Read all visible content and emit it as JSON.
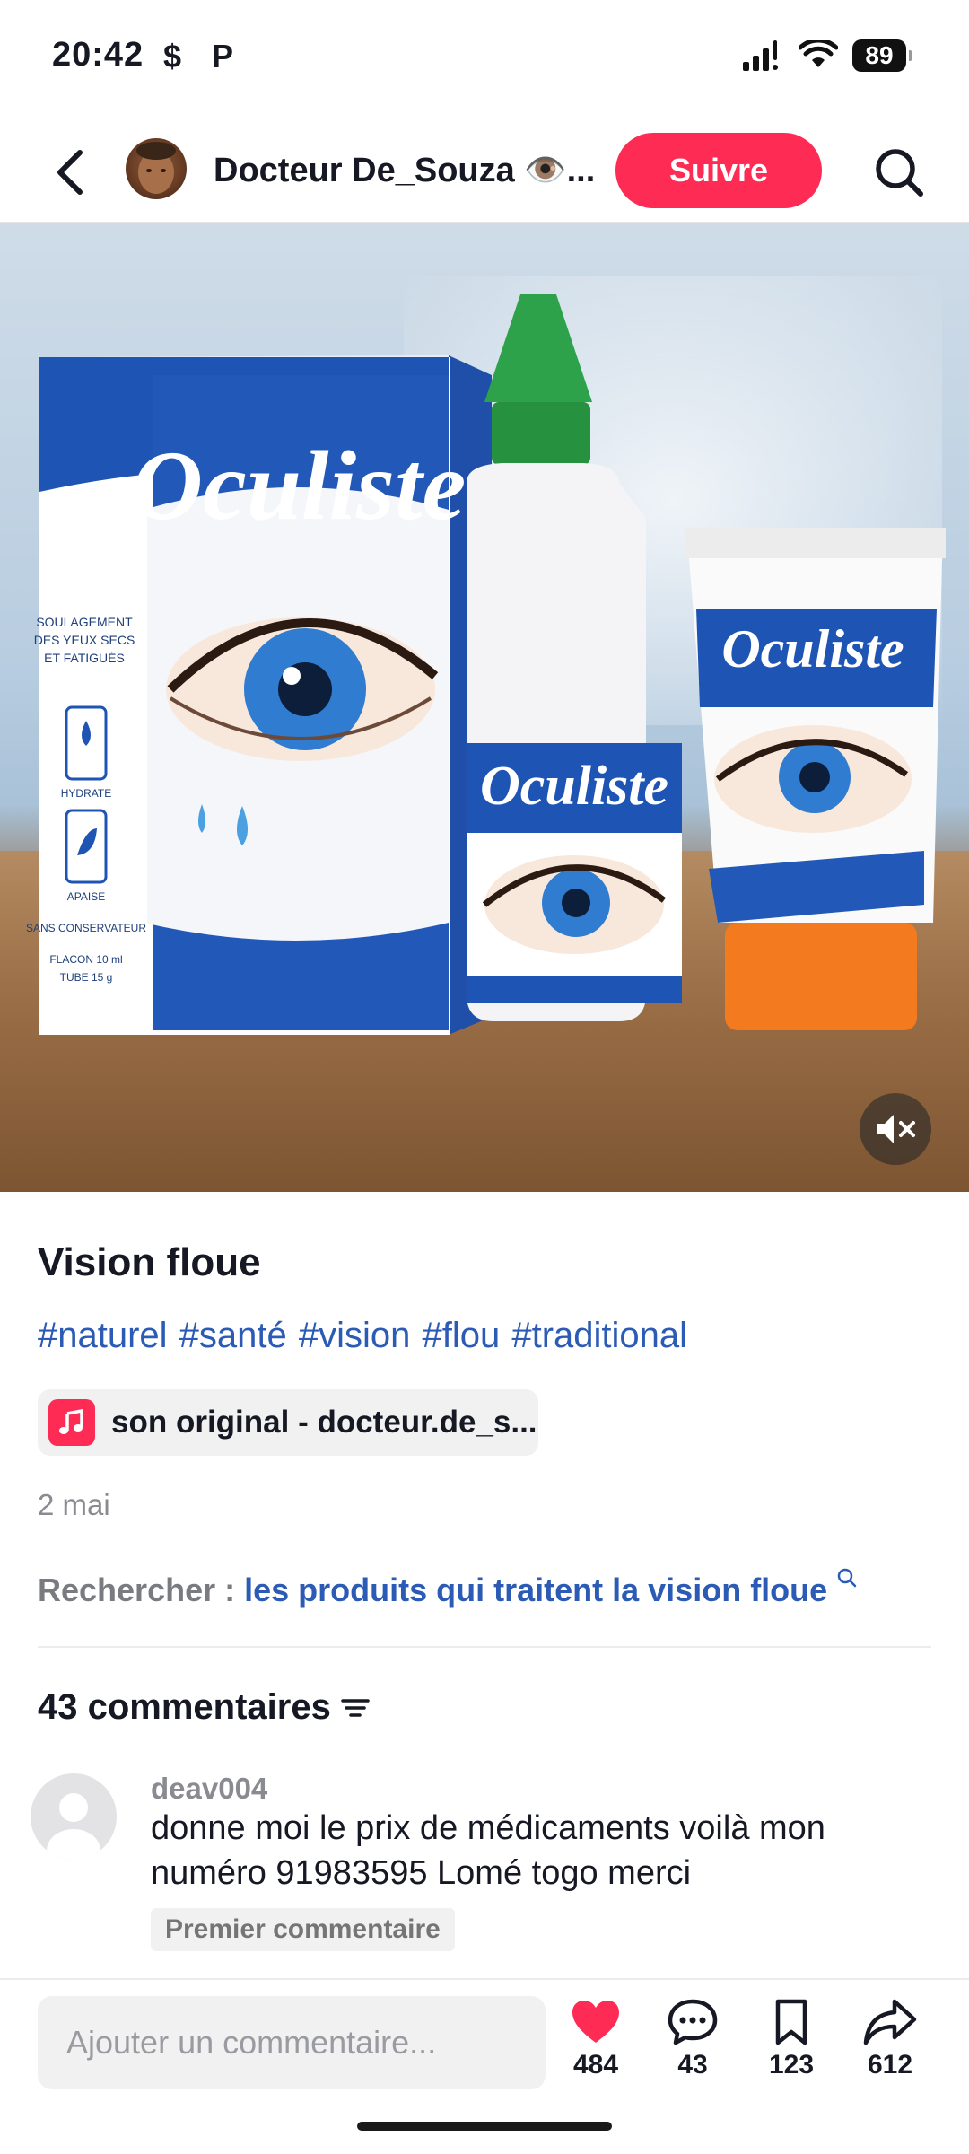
{
  "status_bar": {
    "time": "20:42",
    "app_icons": [
      "$",
      "P"
    ],
    "battery": "89"
  },
  "header": {
    "account_name": "Docteur De_Souza 👁️...",
    "follow_label": "Suivre",
    "follow_color": "#fe2c55"
  },
  "hero": {
    "product_brand": "Oculiste",
    "box_text": [
      "SOULAGEMENT",
      "DES YEUX SECS",
      "ET FATIGUÉS",
      "HYDRATE",
      "APAISE",
      "SANS CONSERVATEUR",
      "FLACON 10 ml",
      "TUBE 15 g"
    ]
  },
  "post": {
    "title": "Vision floue",
    "hashtags": "#naturel #santé #vision #flou #traditional",
    "sound": "son original - docteur.de_s...",
    "date": "2 mai",
    "search_prefix": "Rechercher : ",
    "search_query": "les produits qui traitent la vision floue"
  },
  "comments": {
    "header": "43 commentaires",
    "items": [
      {
        "user": "deav004",
        "text": "donne moi le prix de médicaments voilà mon numéro 91983595 Lomé togo merci",
        "badge": "Premier commentaire"
      }
    ]
  },
  "bottom_bar": {
    "input_placeholder": "Ajouter un commentaire...",
    "likes": "484",
    "comments": "43",
    "saves": "123",
    "shares": "612",
    "like_color": "#fe2c55"
  },
  "colors": {
    "accent": "#fe2c55",
    "link": "#2b5bb5",
    "muted": "#8a8b91"
  }
}
